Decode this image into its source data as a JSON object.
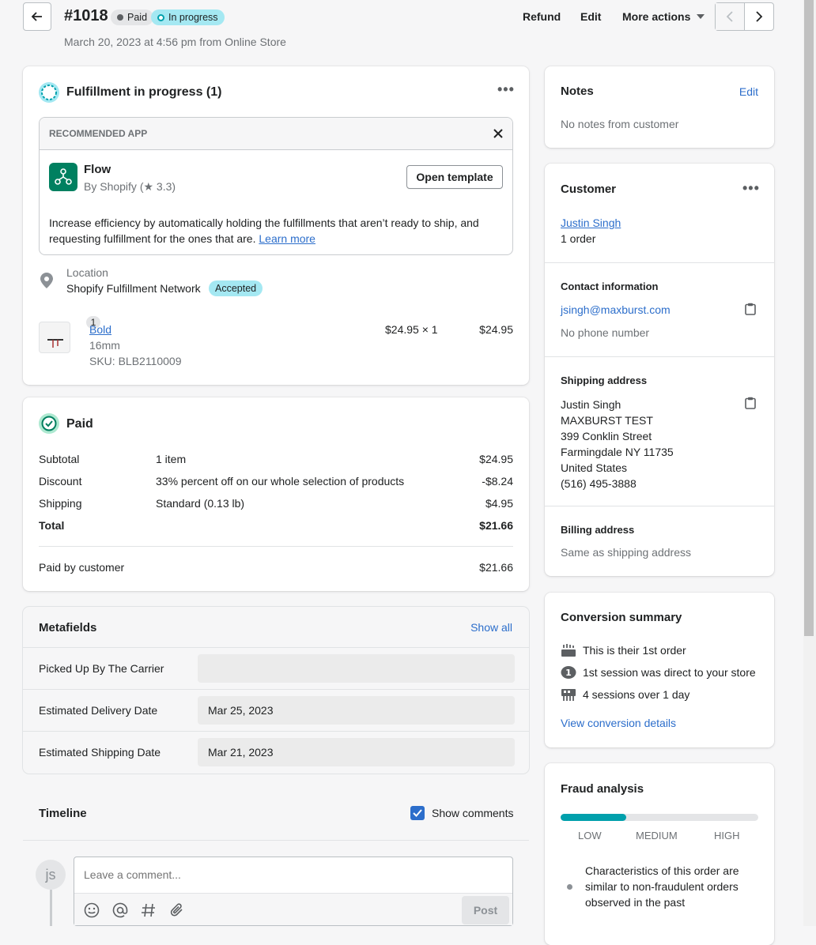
{
  "header": {
    "order_number": "#1018",
    "payment_badge": "Paid",
    "fulfillment_badge": "In progress",
    "subtitle": "March 20, 2023 at 4:56 pm from Online Store",
    "actions": {
      "refund": "Refund",
      "edit": "Edit",
      "more": "More actions"
    }
  },
  "fulfillment": {
    "title": "Fulfillment in progress (1)",
    "recommended": {
      "label": "RECOMMENDED APP",
      "app_name": "Flow",
      "app_by": "By Shopify (★ 3.3)",
      "button": "Open template",
      "description": "Increase efficiency by automatically holding the fulfillments that aren’t ready to ship, and requesting fulfillment for the ones that are.",
      "learn_more": "Learn more"
    },
    "location_label": "Location",
    "location_name": "Shopify Fulfillment Network",
    "location_status": "Accepted",
    "item": {
      "quantity": "1",
      "name": "Bold",
      "variant": "16mm",
      "sku": "SKU: BLB2110009",
      "unit": "$24.95 × 1",
      "total": "$24.95"
    }
  },
  "payment": {
    "title": "Paid",
    "rows": [
      {
        "label": "Subtotal",
        "desc": "1 item",
        "amount": "$24.95"
      },
      {
        "label": "Discount",
        "desc": "33% percent off on our whole selection of products",
        "amount": "-$8.24"
      },
      {
        "label": "Shipping",
        "desc": "Standard (0.13 lb)",
        "amount": "$4.95"
      },
      {
        "label": "Total",
        "desc": "",
        "amount": "$21.66"
      }
    ],
    "paid_label": "Paid by customer",
    "paid_amount": "$21.66"
  },
  "metafields": {
    "title": "Metafields",
    "show_all": "Show all",
    "rows": [
      {
        "label": "Picked Up By The Carrier",
        "value": ""
      },
      {
        "label": "Estimated Delivery Date",
        "value": "Mar 25, 2023"
      },
      {
        "label": "Estimated Shipping Date",
        "value": "Mar 21, 2023"
      }
    ]
  },
  "timeline": {
    "title": "Timeline",
    "show_comments": "Show comments",
    "avatar_initials": "js",
    "comment_placeholder": "Leave a comment...",
    "post": "Post"
  },
  "notes": {
    "title": "Notes",
    "edit": "Edit",
    "body": "No notes from customer"
  },
  "customer": {
    "title": "Customer",
    "name": "Justin Singh",
    "orders": "1 order",
    "contact_title": "Contact information",
    "email": "jsingh@maxburst.com",
    "phone": "No phone number",
    "shipping_title": "Shipping address",
    "shipping_lines": [
      "Justin Singh",
      "MAXBURST TEST",
      "399 Conklin Street",
      "Farmingdale NY 11735",
      "United States",
      "(516) 495-3888"
    ],
    "billing_title": "Billing address",
    "billing_body": "Same as shipping address"
  },
  "conversion": {
    "title": "Conversion summary",
    "items": [
      "This is their 1st order",
      "1st session was direct to your store",
      "4 sessions over 1 day"
    ],
    "link": "View conversion details"
  },
  "fraud": {
    "title": "Fraud analysis",
    "level_fraction": 0.33,
    "levels": [
      "LOW",
      "MEDIUM",
      "HIGH"
    ],
    "note": "Characteristics of this order are similar to non-fraudulent orders observed in the past",
    "accent": "#00a0ac"
  }
}
